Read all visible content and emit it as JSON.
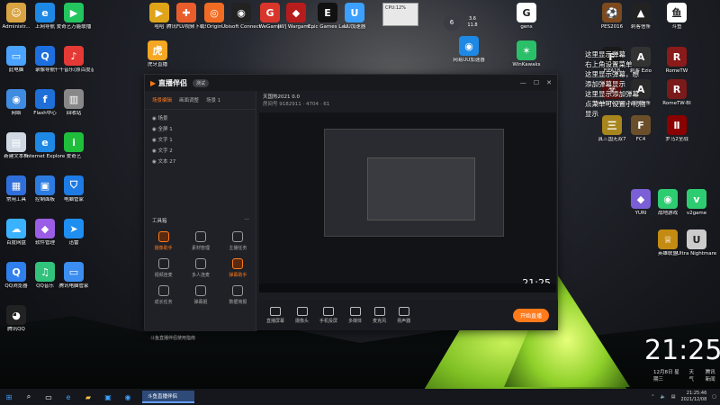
{
  "desktop": {
    "left_icons": [
      {
        "label": "Administr...",
        "glyph": "☺",
        "color": "#d9a441"
      },
      {
        "label": "上网导航",
        "glyph": "e",
        "color": "#1e88e5"
      },
      {
        "label": "爱奇艺万能联播",
        "glyph": "▶",
        "color": "#22c55e"
      },
      {
        "label": "此电脑",
        "glyph": "▭",
        "color": "#4aa3ff"
      },
      {
        "label": "录像导航",
        "glyph": "Q",
        "color": "#1d6fe0"
      },
      {
        "label": "千千音乐(原百度音乐)",
        "glyph": "♪",
        "color": "#e53935"
      },
      {
        "label": "网络",
        "glyph": "◉",
        "color": "#3f8be0"
      },
      {
        "label": "Flash中心",
        "glyph": "f",
        "color": "#1e6fd8"
      },
      {
        "label": "回收站",
        "glyph": "▥",
        "color": "#888888"
      },
      {
        "label": "新建文本档",
        "glyph": "▤",
        "color": "#cfd8e3"
      },
      {
        "label": "Internet Explorer",
        "glyph": "e",
        "color": "#1e88e5"
      },
      {
        "label": "爱奇艺",
        "glyph": "i",
        "color": "#1fbf3c"
      },
      {
        "label": "常用工具",
        "glyph": "▦",
        "color": "#2f6fdb"
      },
      {
        "label": "控制面板",
        "glyph": "▣",
        "color": "#2c7be0"
      },
      {
        "label": "电脑管家",
        "glyph": "⛉",
        "color": "#1e7be5"
      },
      {
        "label": "百度网盘",
        "glyph": "☁",
        "color": "#3ab2ff"
      },
      {
        "label": "软件管理",
        "glyph": "◆",
        "color": "#9b5de5"
      },
      {
        "label": "迅雷",
        "glyph": "➤",
        "color": "#1f8ef1"
      },
      {
        "label": "QQ浏览器",
        "glyph": "Q",
        "color": "#2f80ed"
      },
      {
        "label": "QQ音乐",
        "glyph": "♫",
        "color": "#31c27c"
      },
      {
        "label": "腾讯电脑管家",
        "glyph": "▭",
        "color": "#3b8df0"
      },
      {
        "label": "腾讯QQ",
        "glyph": "◕",
        "color": "#222222"
      }
    ],
    "top_icons": [
      {
        "label": "哈哈",
        "glyph": "▶",
        "color": "#e0a418"
      },
      {
        "label": "腾讯FLV视频下载软件",
        "glyph": "✚",
        "color": "#e85d2b"
      },
      {
        "label": "Origin",
        "glyph": "◎",
        "color": "#f26b22"
      },
      {
        "label": "Ubisoft Connect",
        "glyph": "◉",
        "color": "#222222"
      },
      {
        "label": "WeGame",
        "glyph": "G",
        "color": "#d9362b"
      },
      {
        "label": "[W] Wargami...",
        "glyph": "◆",
        "color": "#b71c1c"
      },
      {
        "label": "Epic Games Launcher",
        "glyph": "E",
        "color": "#111111"
      },
      {
        "label": "UU加速器",
        "glyph": "U",
        "color": "#3ba0ff"
      },
      {
        "label": "虎牙直播",
        "glyph": "虎",
        "color": "#f5a623"
      },
      {
        "label": "网易UU加速器",
        "glyph": "◉",
        "color": "#1e88e5"
      },
      {
        "label": "gens",
        "glyph": "G",
        "color": "#ffffff"
      },
      {
        "label": "WinKawaks",
        "glyph": "✶",
        "color": "#2bbf6a"
      }
    ],
    "right_icons": [
      {
        "label": "PES2016",
        "glyph": "⚽",
        "color": "#7c4a1e"
      },
      {
        "label": "刺客信条",
        "glyph": "▲",
        "color": "#222222"
      },
      {
        "label": "斗鱼",
        "glyph": "鱼",
        "color": "#ffffff"
      },
      {
        "label": "FIFA18",
        "glyph": "F",
        "color": "#1a1a1a"
      },
      {
        "label": "刺客 Ezio",
        "glyph": "A",
        "color": "#333333"
      },
      {
        "label": "RomeTW",
        "glyph": "R",
        "color": "#8b1a1a"
      },
      {
        "label": "Resident Evil 2",
        "glyph": "☣",
        "color": "#5a0e0e"
      },
      {
        "label": "刺客信条",
        "glyph": "A",
        "color": "#2a2a2a"
      },
      {
        "label": "RomeTW-BI",
        "glyph": "R",
        "color": "#7a1a1a"
      },
      {
        "label": "真三国无双7",
        "glyph": "三",
        "color": "#a8861e"
      },
      {
        "label": "FC4",
        "glyph": "F",
        "color": "#6b4f2a"
      },
      {
        "label": "罗马2全战",
        "glyph": "Ⅱ",
        "color": "#8b0000"
      },
      {
        "label": "YURI",
        "glyph": "◆",
        "color": "#7a5fd6"
      },
      {
        "label": "战地游戏",
        "glyph": "◉",
        "color": "#2ecc71"
      },
      {
        "label": "v2game",
        "glyph": "v",
        "color": "#2ecc71"
      },
      {
        "label": "英雄联盟",
        "glyph": "♕",
        "color": "#c48b12"
      },
      {
        "label": "Ultra Nightmare",
        "glyph": "U",
        "color": "#cccccc"
      }
    ]
  },
  "app": {
    "name": "直播伴侣",
    "version_badge": "测试",
    "tabs": [
      "场景编辑",
      "画面调整",
      "场景 1"
    ],
    "scenes": [
      "场景",
      "全屏 1",
      "文字 1",
      "文字 2",
      "文本 27"
    ],
    "tools_title": "工具箱",
    "tools": [
      {
        "label": "摄像助手",
        "hot": true
      },
      {
        "label": "素材管理",
        "hot": false
      },
      {
        "label": "主播任务",
        "hot": false
      },
      {
        "label": "视频连麦",
        "hot": false
      },
      {
        "label": "多人连麦",
        "hot": false
      },
      {
        "label": "弹幕助手",
        "hot": true
      },
      {
        "label": "成长任务",
        "hot": false
      },
      {
        "label": "弹幕姬",
        "hot": false
      },
      {
        "label": "数据简报",
        "hot": false
      }
    ],
    "room_title": "天国热2021 0.0",
    "room_meta": "房间号 9182911 · 4704 · 61",
    "controls": [
      "直播屏幕",
      "摄像头",
      "手机投屏",
      "多媒体",
      "麦克风",
      "扬声器"
    ],
    "live_button": "开始直播",
    "status": "斗鱼直播伴侣使用指南",
    "preview_time": "21:25",
    "preview_timer": "00:00:00"
  },
  "chat": {
    "lines": [
      "这里显示弹幕",
      "右上角设置菜单",
      "这里显示弹幕，想",
      "添加弹幕显示",
      "这里显示添加弹幕",
      "点菜单可设置小礼物",
      "显示"
    ]
  },
  "clock": {
    "time": "21:25",
    "date": "12月8日 星期三",
    "weather": "天气",
    "news": "腾讯新闻"
  },
  "tray": {
    "time": "21:25:46",
    "date": "2021/12/08"
  },
  "overlay": {
    "cpu": "CPU:12%",
    "net": "3.6\n11.8",
    "circle": "6"
  },
  "taskbar": {
    "active_app": "斗鱼直播伴侣"
  }
}
